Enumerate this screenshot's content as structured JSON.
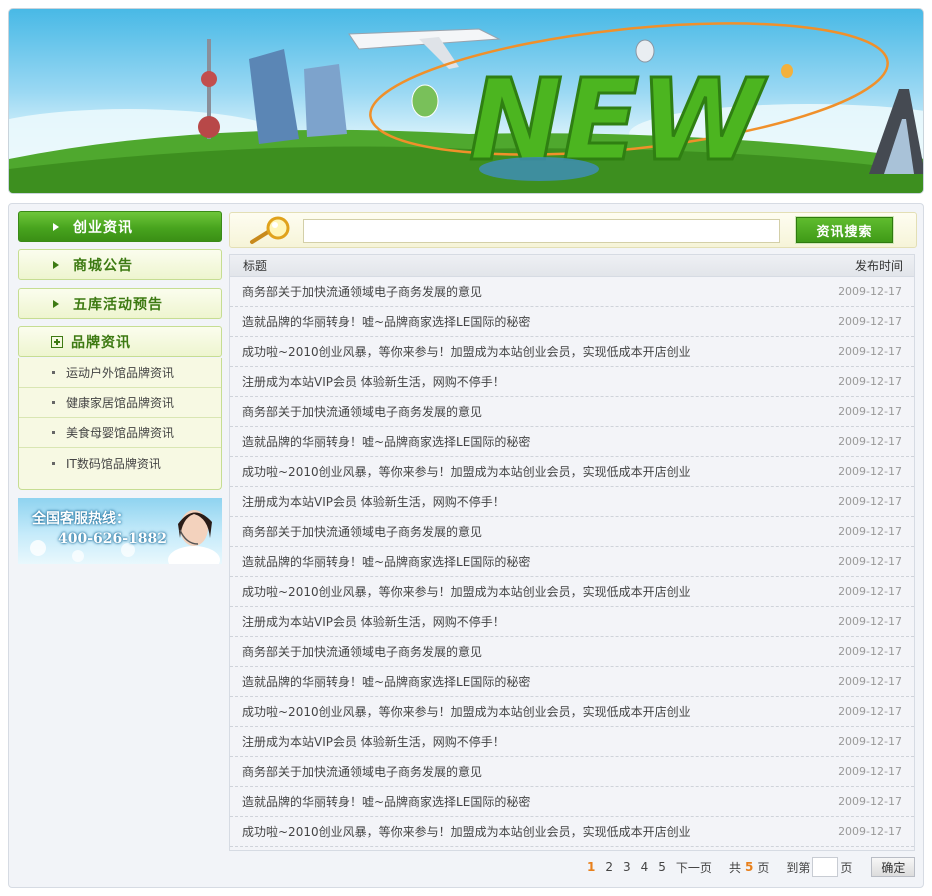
{
  "banner": {
    "word": "NEW"
  },
  "sidebar": {
    "items": [
      {
        "label": "创业资讯"
      },
      {
        "label": "商城公告"
      },
      {
        "label": "五库活动预告"
      },
      {
        "label": "品牌资讯"
      }
    ],
    "subitems": [
      {
        "label": "运动户外馆品牌资讯"
      },
      {
        "label": "健康家居馆品牌资讯"
      },
      {
        "label": "美食母婴馆品牌资讯"
      },
      {
        "label": "IT数码馆品牌资讯"
      }
    ],
    "hotline": {
      "title": "全国客服热线：",
      "phone": "400-626-1882"
    }
  },
  "search": {
    "placeholder": "",
    "button_label": "资讯搜索"
  },
  "table": {
    "headers": {
      "title": "标题",
      "date": "发布时间"
    },
    "rows": [
      {
        "title": "商务部关于加快流通领域电子商务发展的意见",
        "date": "2009-12-17"
      },
      {
        "title": "造就品牌的华丽转身！嘘~品牌商家选择LE国际的秘密",
        "date": "2009-12-17"
      },
      {
        "title": "成功啦~2010创业风暴，等你来参与！加盟成为本站创业会员，实现低成本开店创业",
        "date": "2009-12-17"
      },
      {
        "title": "注册成为本站VIP会员 体验新生活，网购不停手！",
        "date": "2009-12-17"
      },
      {
        "title": "商务部关于加快流通领域电子商务发展的意见",
        "date": "2009-12-17"
      },
      {
        "title": "造就品牌的华丽转身！嘘~品牌商家选择LE国际的秘密",
        "date": "2009-12-17"
      },
      {
        "title": "成功啦~2010创业风暴，等你来参与！加盟成为本站创业会员，实现低成本开店创业",
        "date": "2009-12-17"
      },
      {
        "title": "注册成为本站VIP会员 体验新生活，网购不停手！",
        "date": "2009-12-17"
      },
      {
        "title": "商务部关于加快流通领域电子商务发展的意见",
        "date": "2009-12-17"
      },
      {
        "title": "造就品牌的华丽转身！嘘~品牌商家选择LE国际的秘密",
        "date": "2009-12-17"
      },
      {
        "title": "成功啦~2010创业风暴，等你来参与！加盟成为本站创业会员，实现低成本开店创业",
        "date": "2009-12-17"
      },
      {
        "title": "注册成为本站VIP会员 体验新生活，网购不停手！",
        "date": "2009-12-17"
      },
      {
        "title": "商务部关于加快流通领域电子商务发展的意见",
        "date": "2009-12-17"
      },
      {
        "title": "造就品牌的华丽转身！嘘~品牌商家选择LE国际的秘密",
        "date": "2009-12-17"
      },
      {
        "title": "成功啦~2010创业风暴，等你来参与！加盟成为本站创业会员，实现低成本开店创业",
        "date": "2009-12-17"
      },
      {
        "title": "注册成为本站VIP会员 体验新生活，网购不停手！",
        "date": "2009-12-17"
      },
      {
        "title": "商务部关于加快流通领域电子商务发展的意见",
        "date": "2009-12-17"
      },
      {
        "title": "造就品牌的华丽转身！嘘~品牌商家选择LE国际的秘密",
        "date": "2009-12-17"
      },
      {
        "title": "成功啦~2010创业风暴，等你来参与！加盟成为本站创业会员，实现低成本开店创业",
        "date": "2009-12-17"
      }
    ]
  },
  "pager": {
    "pages": [
      "1",
      "2",
      "3",
      "4",
      "5"
    ],
    "current": "1",
    "next_label": "下一页",
    "total_prefix": "共",
    "total": "5",
    "total_suffix": "页",
    "goto_prefix": "到第",
    "goto_suffix": "页",
    "go_label": "确定"
  },
  "colors": {
    "accent_green": "#48a41e",
    "current_page": "#e8801c"
  }
}
